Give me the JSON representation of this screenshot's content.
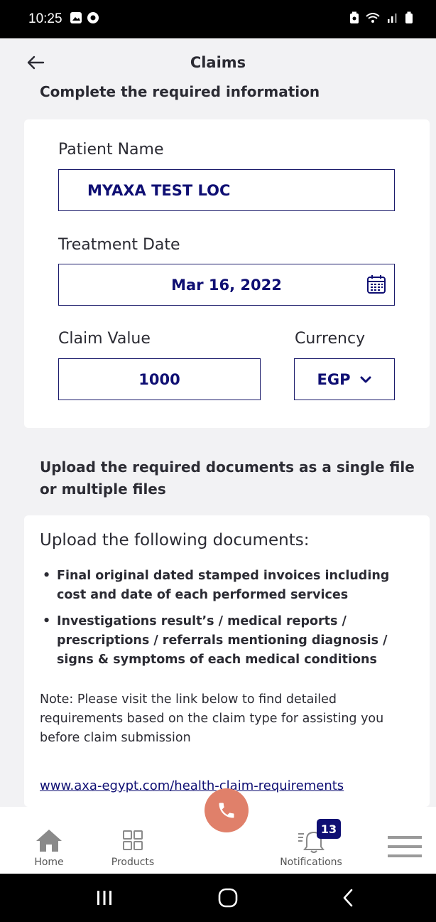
{
  "status_bar": {
    "time": "10:25"
  },
  "header": {
    "title": "Claims"
  },
  "section_info": {
    "heading": "Complete the required information"
  },
  "form": {
    "patient_name": {
      "label": "Patient Name",
      "value": "MYAXA TEST LOC"
    },
    "treatment_date": {
      "label": "Treatment Date",
      "value": "Mar 16, 2022"
    },
    "claim_value": {
      "label": "Claim Value",
      "value": "1000"
    },
    "currency": {
      "label": "Currency",
      "value": "EGP"
    }
  },
  "section_upload": {
    "heading": "Upload the required documents as a single file or multiple files"
  },
  "upload_card": {
    "title": "Upload the following documents:",
    "items": [
      "Final original dated stamped invoices including cost and date of each performed services",
      "Investigations result’s / medical reports / prescriptions / referrals mentioning diagnosis / signs & symptoms of each medical conditions"
    ],
    "note": "Note: Please visit the link below to find detailed requirements based on the claim type for assisting you before claim submission",
    "link": "www.axa-egypt.com/health-claim-requirements"
  },
  "bottom_nav": {
    "home": "Home",
    "products": "Products",
    "notifications": "Notifications",
    "notifications_count": "13"
  },
  "colors": {
    "primary": "#0f0f73",
    "call_button": "#e0806a",
    "background": "#f2f2f4"
  }
}
